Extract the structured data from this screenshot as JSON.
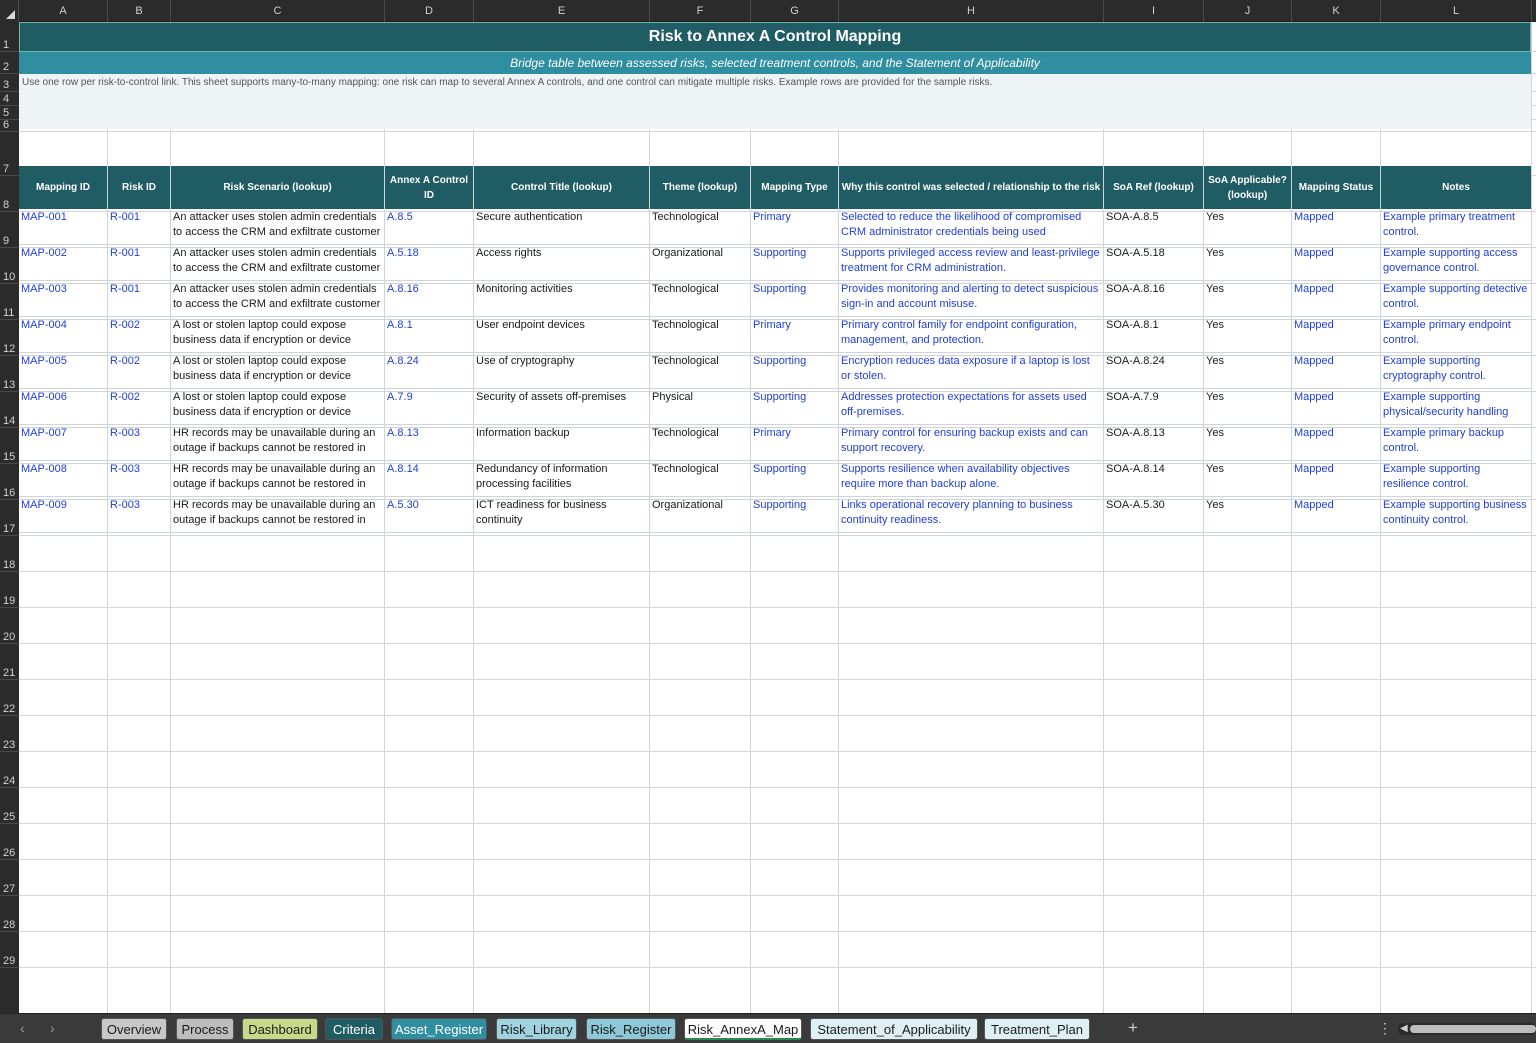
{
  "columns": [
    "A",
    "B",
    "C",
    "D",
    "E",
    "F",
    "G",
    "H",
    "I",
    "J",
    "K",
    "L"
  ],
  "row_numbers": [
    "1",
    "2",
    "3",
    "4",
    "5",
    "6",
    "7",
    "8",
    "9",
    "10",
    "11",
    "12",
    "13",
    "14",
    "15",
    "16",
    "17",
    "18",
    "19",
    "20",
    "21",
    "22",
    "23",
    "24",
    "25",
    "26",
    "27",
    "28",
    "29"
  ],
  "title": "Risk to Annex A Control Mapping",
  "subtitle": "Bridge table between assessed risks, selected treatment controls, and the Statement of Applicability",
  "instructions": "Use one row per risk-to-control link. This sheet supports many-to-many mapping: one risk can map to several Annex A controls, and one control can mitigate multiple risks. Example rows are provided for the sample risks.",
  "headers": [
    "Mapping ID",
    "Risk ID",
    "Risk Scenario (lookup)",
    "Annex A Control ID",
    "Control Title (lookup)",
    "Theme (lookup)",
    "Mapping Type",
    "Why this control was selected / relationship to the risk",
    "SoA Ref (lookup)",
    "SoA Applicable? (lookup)",
    "Mapping Status",
    "Notes"
  ],
  "rows": [
    [
      "MAP-001",
      "R-001",
      "An attacker uses stolen admin credentials to access the CRM and exfiltrate customer",
      "A.8.5",
      "Secure authentication",
      "Technological",
      "Primary",
      "Selected to reduce the likelihood of compromised CRM administrator credentials being used",
      "SOA-A.8.5",
      "Yes",
      "Mapped",
      "Example primary treatment control."
    ],
    [
      "MAP-002",
      "R-001",
      "An attacker uses stolen admin credentials to access the CRM and exfiltrate customer",
      "A.5.18",
      "Access rights",
      "Organizational",
      "Supporting",
      "Supports privileged access review and least-privilege treatment for CRM administration.",
      "SOA-A.5.18",
      "Yes",
      "Mapped",
      "Example supporting access governance control."
    ],
    [
      "MAP-003",
      "R-001",
      "An attacker uses stolen admin credentials to access the CRM and exfiltrate customer",
      "A.8.16",
      "Monitoring activities",
      "Technological",
      "Supporting",
      "Provides monitoring and alerting to detect suspicious sign-in and account misuse.",
      "SOA-A.8.16",
      "Yes",
      "Mapped",
      "Example supporting detective control."
    ],
    [
      "MAP-004",
      "R-002",
      "A lost or stolen laptop could expose business data if encryption or device",
      "A.8.1",
      "User endpoint devices",
      "Technological",
      "Primary",
      "Primary control family for endpoint configuration, management, and protection.",
      "SOA-A.8.1",
      "Yes",
      "Mapped",
      "Example primary endpoint control."
    ],
    [
      "MAP-005",
      "R-002",
      "A lost or stolen laptop could expose business data if encryption or device",
      "A.8.24",
      "Use of cryptography",
      "Technological",
      "Supporting",
      "Encryption reduces data exposure if a laptop is lost or stolen.",
      "SOA-A.8.24",
      "Yes",
      "Mapped",
      "Example supporting cryptography control."
    ],
    [
      "MAP-006",
      "R-002",
      "A lost or stolen laptop could expose business data if encryption or device",
      "A.7.9",
      "Security of assets off-premises",
      "Physical",
      "Supporting",
      "Addresses protection expectations for assets used off-premises.",
      "SOA-A.7.9",
      "Yes",
      "Mapped",
      "Example supporting physical/security handling"
    ],
    [
      "MAP-007",
      "R-003",
      "HR records may be unavailable during an outage if backups cannot be restored in",
      "A.8.13",
      "Information backup",
      "Technological",
      "Primary",
      "Primary control for ensuring backup exists and can support recovery.",
      "SOA-A.8.13",
      "Yes",
      "Mapped",
      "Example primary backup control."
    ],
    [
      "MAP-008",
      "R-003",
      "HR records may be unavailable during an outage if backups cannot be restored in",
      "A.8.14",
      "Redundancy of information processing facilities",
      "Technological",
      "Supporting",
      "Supports resilience when availability objectives require more than backup alone.",
      "SOA-A.8.14",
      "Yes",
      "Mapped",
      "Example supporting resilience control."
    ],
    [
      "MAP-009",
      "R-003",
      "HR records may be unavailable during an outage if backups cannot be restored in",
      "A.5.30",
      "ICT readiness for business continuity",
      "Organizational",
      "Supporting",
      "Links operational recovery planning to business continuity readiness.",
      "SOA-A.5.30",
      "Yes",
      "Mapped",
      "Example supporting business continuity control."
    ]
  ],
  "tabs": [
    {
      "label": "Overview",
      "color": "#c8c8c8"
    },
    {
      "label": "Process",
      "color": "#bdbdbd"
    },
    {
      "label": "Dashboard",
      "color": "#c9d98a"
    },
    {
      "label": "Criteria",
      "color": "#1f5c63"
    },
    {
      "label": "Asset_Register",
      "color": "#2f8ea0"
    },
    {
      "label": "Risk_Library",
      "color": "#9fd3e0"
    },
    {
      "label": "Risk_Register",
      "color": "#8fc9d9"
    },
    {
      "label": "Risk_AnnexA_Map",
      "color": "#ffffff"
    },
    {
      "label": "Statement_of_Applicability",
      "color": "#dff0f4"
    },
    {
      "label": "Treatment_Plan",
      "color": "#dff0f4"
    }
  ],
  "active_tab": "Risk_AnnexA_Map",
  "icons": {
    "prev": "chevron-left-icon",
    "next": "chevron-right-icon",
    "add": "plus-icon",
    "more": "vertical-dots-icon"
  },
  "colors": {
    "header_fill": "#1f5c63",
    "subtitle_fill": "#2f8ea0",
    "link_blue": "#1f3fd6"
  }
}
